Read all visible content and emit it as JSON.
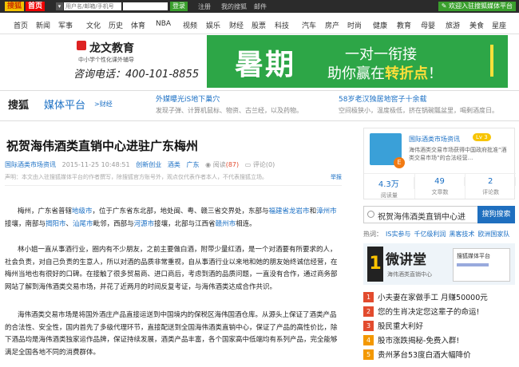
{
  "topbar": {
    "logo_sohu": "搜狐",
    "logo_home": "首页",
    "user_placeholder": "用户名/邮箱/手机号",
    "login": "登录",
    "register": "注册",
    "my_sohu": "我的搜狐",
    "mail": "邮件",
    "entry": "欢迎入驻搜狐媒体平台"
  },
  "nav": [
    "首页",
    "新闻",
    "军事",
    "文化",
    "历史",
    "体育",
    "NBA",
    "视频",
    "娱乐",
    "财经",
    "股票",
    "科技",
    "汽车",
    "房产",
    "时尚",
    "健康",
    "教育",
    "母婴",
    "旅游",
    "美食",
    "星座"
  ],
  "banner": {
    "brand": "龙文教育",
    "tagline": "中小学个性化课外辅导",
    "phone": "咨询电话：400-101-8855",
    "big": "暑期",
    "line1": "一对一衔接",
    "line2_a": "助你赢在",
    "line2_b": "转折点",
    "line2_c": "！"
  },
  "platform": {
    "sohu": "搜狐",
    "media": "媒体平台",
    "finance": ">财经"
  },
  "promos": [
    {
      "title": "外媒曝光iS地下巢穴",
      "desc": "发现子弹、计算机鼠标、物资、古兰经，以及药物。"
    },
    {
      "title": "58岁老汉独居地窖子十余载",
      "desc": "空间极狭小，温度极低，挤在锅碗瓢盆里，喝剩酒度日。"
    }
  ],
  "article": {
    "title": "祝贺海伟酒类直销中心进驻广东梅州",
    "source": "国际酒类市场资讯",
    "date": "2015-11-25 10:48:51",
    "tags": [
      "创新创业",
      "酒类",
      "广东"
    ],
    "reads_label": "阅读",
    "reads": "(87)",
    "comments_label": "评论",
    "comments": "(0)",
    "disclaimer": "声明：本文由入驻搜狐媒体平台的作者撰写，除搜狐官方账号外，观点仅代表作者本人，不代表搜狐立场。",
    "report": "举报",
    "p1_a": "梅州，广东省普辖",
    "p1_l1": "地级市",
    "p1_b": "，位于广东省东北部，地处闽、粤、赣三省交界处，东部与",
    "p1_l2": "福建省龙岩市",
    "p1_c": "和",
    "p1_l3": "漳州市",
    "p1_d": "接壤，南部与",
    "p1_l4": "揭阳市",
    "p1_e": "、",
    "p1_l5": "汕尾市",
    "p1_f": "毗邻，西部与",
    "p1_l6": "河源市",
    "p1_g": "接壤，北部与江西省",
    "p1_l7": "赣州市",
    "p1_h": "相连。",
    "p2": "林小姐一直从事酒行业，圈内有不少朋友，之前主要做白酒，附带少量红酒，是一个对酒要有所要求的人，社会负责，对自己负责的生意人，所以对酒的品质非常重视，自从事酒行业以来地和她的朋友始终诚信经营，在梅州当地也有很好的口碑。在接触了很多贸易商、进口商后，考虑到酒的品质问题，一直没有合作，通过商务部网站了解到海伟酒类交易市场，并花了近两月的时间反复考证，与海伟酒类达成合作共识。",
    "p3": "海伟酒类交易市场是将国外酒庄产品直接运送到中国境内的保税区海伟国酒仓库。从源头上保证了酒类产品的合法性、安全性，国内首先了多级代理环节，直接配送到全国海伟酒类直销中心，保证了产品的高性价比，除下酒品均是海伟酒类独家运作品牌，保证持续发展，酒类产品丰富，各个国家高中低端均有系列产品，完全能够满足全国各地不同的消费群体。"
  },
  "side": {
    "name": "国际酒类市场资讯",
    "level": "Lv 3",
    "desc": "海伟酒类交易市场获得中国政府批准“酒类交易市场”的合法经营...",
    "badge": "E",
    "stats": [
      {
        "n": "4.3万",
        "k": "阅读量"
      },
      {
        "n": "49",
        "k": "文章数"
      },
      {
        "n": "2",
        "k": "评论数"
      }
    ],
    "search_value": "祝贺海伟酒类直销中心进",
    "search_btn": "搜狗搜索",
    "hot_label": "热词：",
    "hot": [
      "IS实参与",
      "千亿级利润",
      "黑客技术",
      "欧洲国家队"
    ],
    "ad_num": "1",
    "ad_title": "微讲堂",
    "ad_sub": "海伟酒类直销中心",
    "ad_shot": "搜狐媒体平台",
    "list": [
      {
        "n": "1",
        "t": "小夫妻在家做手工 月赚50000元"
      },
      {
        "n": "2",
        "t": "您的生肖决定您这辈子的命运!"
      },
      {
        "n": "3",
        "t": "股民重大利好"
      },
      {
        "n": "4",
        "t": "股市涨跌揭秘-免费入群!"
      },
      {
        "n": "5",
        "t": "贵州茅台53度白酒大幅降价"
      }
    ]
  }
}
